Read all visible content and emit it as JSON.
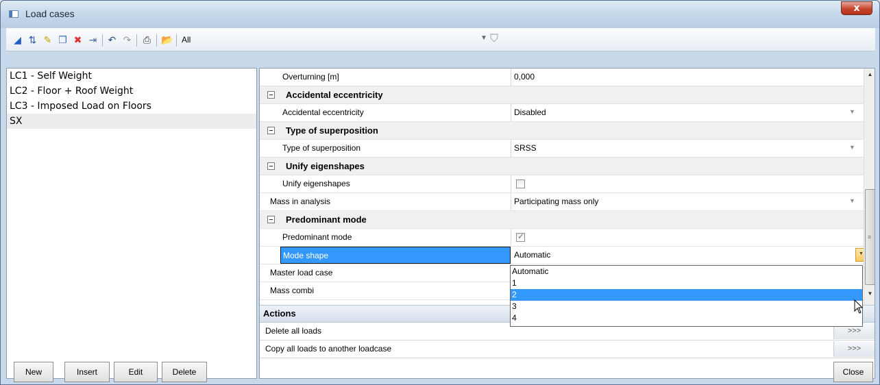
{
  "window": {
    "title": "Load cases",
    "close_label": "x"
  },
  "toolbar": {
    "icons": [
      "new-icon",
      "insert-icon",
      "edit-icon",
      "copy-icon",
      "delete-icon",
      "export-icon",
      "undo-icon",
      "redo-icon",
      "print-icon",
      "open-icon"
    ],
    "filter_value": "All"
  },
  "load_cases": [
    {
      "label": "LC1 - Self Weight"
    },
    {
      "label": "LC2 - Floor + Roof Weight"
    },
    {
      "label": "LC3 - Imposed Load on Floors"
    },
    {
      "label": "SX",
      "selected": true
    }
  ],
  "properties": {
    "overturning": {
      "name": "Overturning [m]",
      "value": "0,000"
    },
    "accidental_cat": "Accidental eccentricity",
    "accidental": {
      "name": "Accidental eccentricity",
      "value": "Disabled"
    },
    "superposition_cat": "Type of superposition",
    "superposition": {
      "name": "Type of superposition",
      "value": "SRSS"
    },
    "unify_cat": "Unify eigenshapes",
    "unify": {
      "name": "Unify eigenshapes",
      "checked": false
    },
    "mass": {
      "name": "Mass in analysis",
      "value": "Participating mass only"
    },
    "predominant_cat": "Predominant mode",
    "predominant": {
      "name": "Predominant mode",
      "checked": true
    },
    "mode_shape": {
      "name": "Mode shape",
      "value": "Automatic"
    },
    "master": {
      "name": "Master load case"
    },
    "mass_combi": {
      "name": "Mass combi"
    }
  },
  "mode_shape_options": [
    "Automatic",
    "1",
    "2",
    "3",
    "4"
  ],
  "mode_shape_highlighted": "2",
  "actions": {
    "header": "Actions",
    "items": [
      {
        "label": "Delete all loads",
        "button": ">>>"
      },
      {
        "label": "Copy all loads to another loadcase",
        "button": ">>>"
      }
    ]
  },
  "buttons": {
    "new": "New",
    "insert": "Insert",
    "edit": "Edit",
    "delete": "Delete",
    "close": "Close"
  }
}
